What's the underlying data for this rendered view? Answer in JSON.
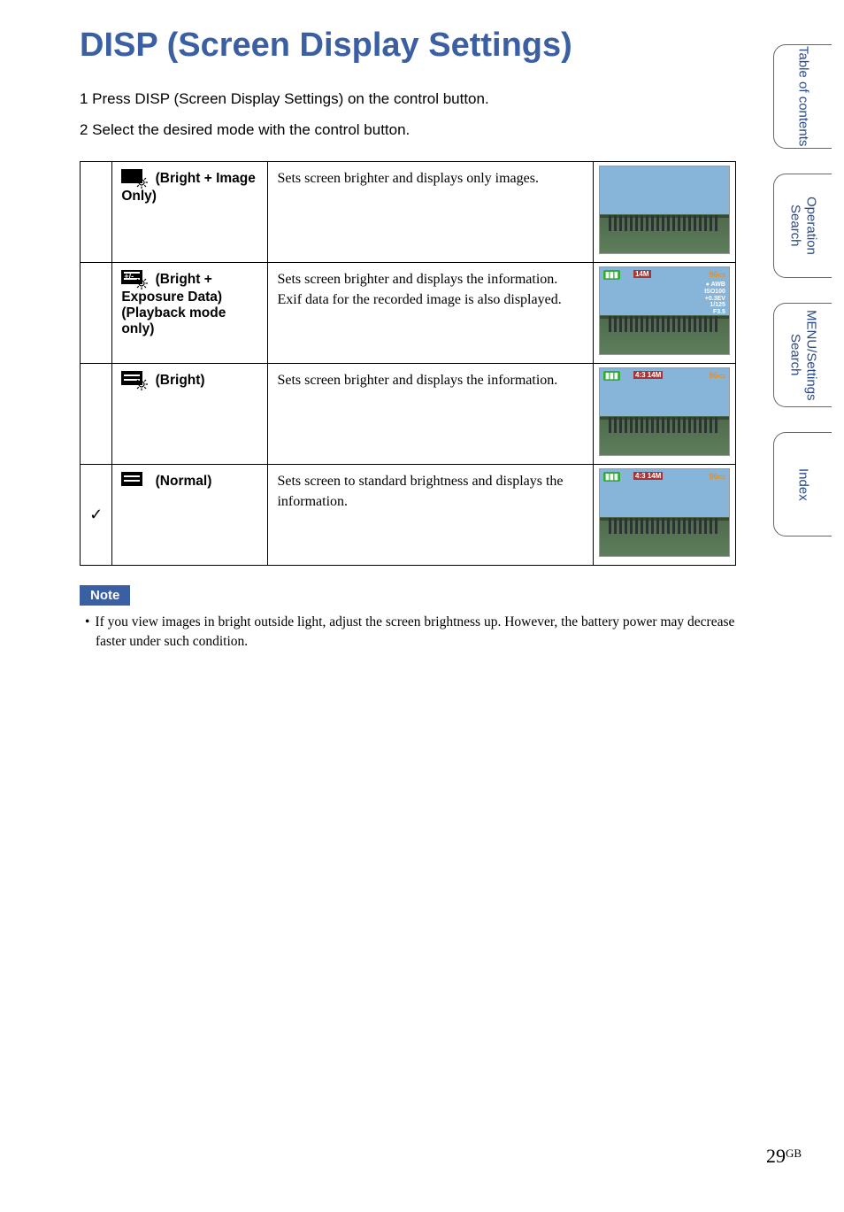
{
  "title": "DISP (Screen Display Settings)",
  "instructions": {
    "step1": "1  Press DISP (Screen Display Settings) on the control button.",
    "step2": "2  Select the desired mode with the control button."
  },
  "modes": [
    {
      "check": "",
      "icon": "bright-image-only-icon",
      "label": " (Bright + Image Only)",
      "desc": "Sets screen brighter and displays only images.",
      "overlay": {
        "show": false
      }
    },
    {
      "check": "",
      "icon": "bright-exposure-icon",
      "label": " (Bright + Exposure Data) (Playback mode only)",
      "desc": "Sets screen brighter and displays the information.\nExif data for the recorded image is also displayed.",
      "overlay": {
        "show": true,
        "mode": "14M",
        "count": "96",
        "exif": true
      }
    },
    {
      "check": "",
      "icon": "bright-icon",
      "label": " (Bright)",
      "desc": "Sets screen brighter and displays the information.",
      "overlay": {
        "show": true,
        "mode": "4:3 14M",
        "count": "96",
        "exif": false
      }
    },
    {
      "check": "✓",
      "icon": "normal-icon",
      "label": " (Normal)",
      "desc": "Sets screen to standard brightness and displays the information.",
      "overlay": {
        "show": true,
        "mode": "4:3 14M",
        "count": "96",
        "exif": false
      }
    }
  ],
  "note": {
    "label": "Note",
    "text": "If you view images in bright outside light, adjust the screen brightness up. However, the battery power may decrease faster under such condition."
  },
  "tabs": [
    {
      "label": "Table of contents"
    },
    {
      "label": "Operation Search"
    },
    {
      "label": "MENU/Settings Search"
    },
    {
      "label": "Index"
    }
  ],
  "page": {
    "num": "29",
    "suffix": "GB"
  }
}
